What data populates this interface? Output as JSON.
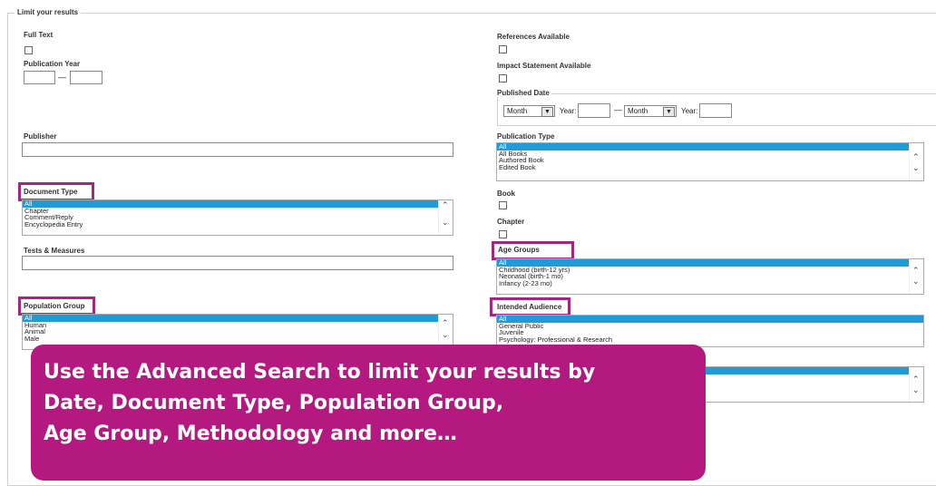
{
  "form": {
    "legend": "Limit your results",
    "left": {
      "full_text": "Full Text",
      "publication_year": "Publication Year",
      "year_dash": "—",
      "publisher": "Publisher",
      "document_type": {
        "label": "Document Type",
        "options": [
          "All",
          "Chapter",
          "Comment/Reply",
          "Encyclopedia Entry"
        ]
      },
      "tests_measures": "Tests & Measures",
      "population_group": {
        "label": "Population Group",
        "options": [
          "All",
          "Human",
          "Animal",
          "Male"
        ]
      }
    },
    "right": {
      "references_available": "References Available",
      "impact_statement": "Impact Statement Available",
      "published_date": {
        "legend": "Published Date",
        "month1": "Month",
        "year1_label": "Year:",
        "dash": "—",
        "month2": "Month",
        "year2_label": "Year:"
      },
      "publication_type": {
        "label": "Publication Type",
        "options": [
          "All",
          "All Books",
          "Authored Book",
          "Edited Book"
        ]
      },
      "book": "Book",
      "chapter": "Chapter",
      "age_groups": {
        "label": "Age Groups",
        "options": [
          "All",
          "Childhood (birth-12 yrs)",
          "Neonatal (birth-1 mo)",
          "Infancy (2-23 mo)"
        ]
      },
      "intended_audience": {
        "label": "Intended Audience",
        "options": [
          "All",
          "General Public",
          "Juvenile",
          "Psychology: Professional & Research"
        ]
      }
    }
  },
  "callout": {
    "line1": "Use the Advanced Search to limit your results by",
    "line2": "Date, Document Type, Population Group,",
    "line3": "Age Group, Methodology and more…"
  },
  "colors": {
    "highlight": "#a3267f",
    "selected_option": "#1e9bd8",
    "callout_bg": "#b3197f"
  }
}
